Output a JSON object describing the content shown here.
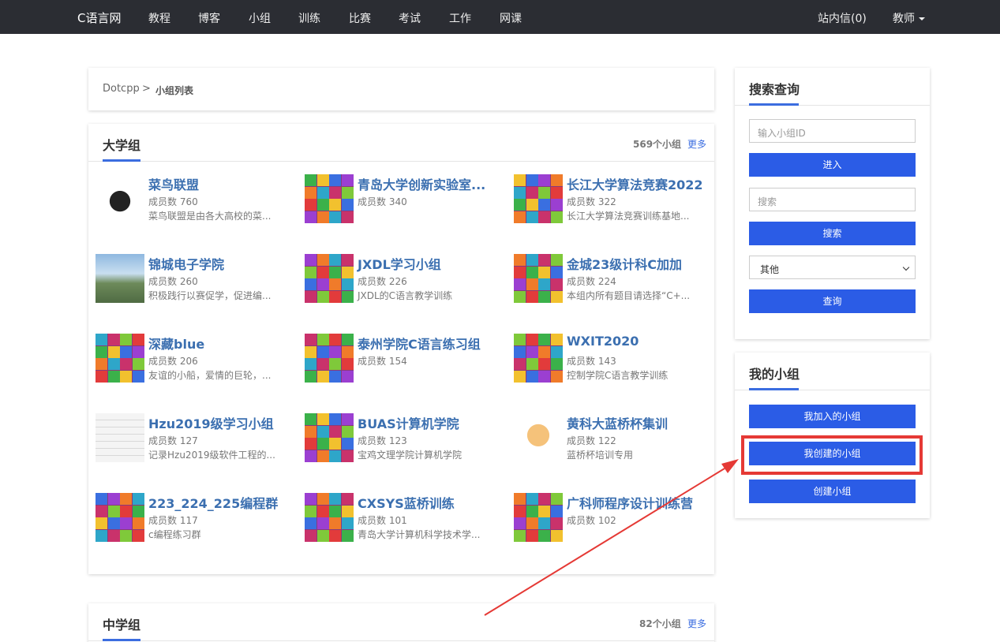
{
  "navbar": {
    "brand": "C语言网",
    "items": [
      "教程",
      "博客",
      "小组",
      "训练",
      "比赛",
      "考试",
      "工作",
      "网课"
    ],
    "messages": "站内信(0)",
    "user": "教师"
  },
  "breadcrumb": {
    "root": "Dotcpp",
    "separator": ">",
    "current": "小组列表"
  },
  "university": {
    "title": "大学组",
    "count": "569个小组",
    "more": "更多",
    "groups": [
      {
        "name": "菜鸟联盟",
        "count": "成员数 760",
        "desc": "菜鸟联盟是由各大高校的菜...",
        "thumb": "cartoon"
      },
      {
        "name": "青岛大学创新实验室...",
        "count": "成员数 340",
        "desc": "",
        "thumb": "cube"
      },
      {
        "name": "长江大学算法竞赛2022",
        "count": "成员数 322",
        "desc": "长江大学算法竞赛训练基地...",
        "thumb": "cube"
      },
      {
        "name": "锦城电子学院",
        "count": "成员数 260",
        "desc": "积极践行以赛促学，促进编...",
        "thumb": "campus"
      },
      {
        "name": "JXDL学习小组",
        "count": "成员数 226",
        "desc": "JXDL的C语言教学训练",
        "thumb": "cube"
      },
      {
        "name": "金城23级计科C加加",
        "count": "成员数 224",
        "desc": "本组内所有题目请选择“C+...",
        "thumb": "cube"
      },
      {
        "name": "深藏blue",
        "count": "成员数 206",
        "desc": "友谊的小船，爱情的巨轮，...",
        "thumb": "cube"
      },
      {
        "name": "泰州学院C语言练习组",
        "count": "成员数 154",
        "desc": "",
        "thumb": "cube"
      },
      {
        "name": "WXIT2020",
        "count": "成员数 143",
        "desc": "控制学院C语言教学训练",
        "thumb": "cube"
      },
      {
        "name": "Hzu2019级学习小组",
        "count": "成员数 127",
        "desc": "记录Hzu2019级软件工程的...",
        "thumb": "note"
      },
      {
        "name": "BUAS计算机学院",
        "count": "成员数 123",
        "desc": "宝鸡文理学院计算机学院",
        "thumb": "cube"
      },
      {
        "name": "黄科大蓝桥杯集训",
        "count": "成员数 122",
        "desc": "蓝桥杯培训专用",
        "thumb": "anime"
      },
      {
        "name": "223_224_225编程群",
        "count": "成员数 117",
        "desc": "c编程练习群",
        "thumb": "cube"
      },
      {
        "name": "CXSYS蓝桥训练",
        "count": "成员数 101",
        "desc": "青岛大学计算机科学技术学...",
        "thumb": "cube"
      },
      {
        "name": "广科师程序设计训练营",
        "count": "成员数 102",
        "desc": "",
        "thumb": "cube"
      }
    ]
  },
  "middle": {
    "title": "中学组",
    "count": "82个小组",
    "more": "更多"
  },
  "search": {
    "title": "搜索查询",
    "id_placeholder": "输入小组ID",
    "enter_label": "进入",
    "keyword_placeholder": "搜索",
    "search_label": "搜索",
    "category_selected": "其他",
    "query_label": "查询"
  },
  "mygroups": {
    "title": "我的小组",
    "joined_label": "我加入的小组",
    "created_label": "我创建的小组",
    "create_label": "创建小组"
  },
  "colors": {
    "accent": "#2b5ce6",
    "link": "#3b6fb0",
    "highlight": "#e53935",
    "nav_bg": "#2b2d33"
  }
}
